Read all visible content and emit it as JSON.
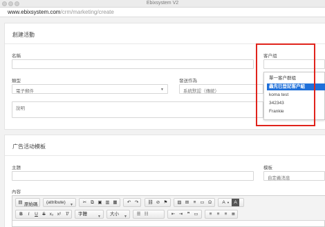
{
  "window": {
    "title": "Ebixsystem V2"
  },
  "address_bar": {
    "host": "www.ebixsystem.com",
    "path": "/crm/marketing/create"
  },
  "create_panel": {
    "heading": "創建活動",
    "name_label": "名稱",
    "type_label": "類型",
    "type_value": "電子郵件",
    "send_as_label": "發送作為",
    "send_as_value": "系統默認（傳統）",
    "description_placeholder": "說明",
    "customer_group_label": "客户组",
    "customer_group_options": [
      "單一客户群组",
      "蟲先已登記客户組",
      "koma test",
      "342343",
      "Frankie"
    ],
    "customer_group_selected_index": 1
  },
  "template_panel": {
    "heading": "广告活动模板",
    "subject_label": "主題",
    "template_label": "模板",
    "template_value": "自定義消息",
    "content_label": "內容"
  },
  "editor": {
    "source_label": "原始碼",
    "attribute_select": "(attribute)",
    "font_select": "字體",
    "size_select": "大小"
  },
  "colors": {
    "accent": "#1e6fd9",
    "annotation": "#e0231b"
  }
}
